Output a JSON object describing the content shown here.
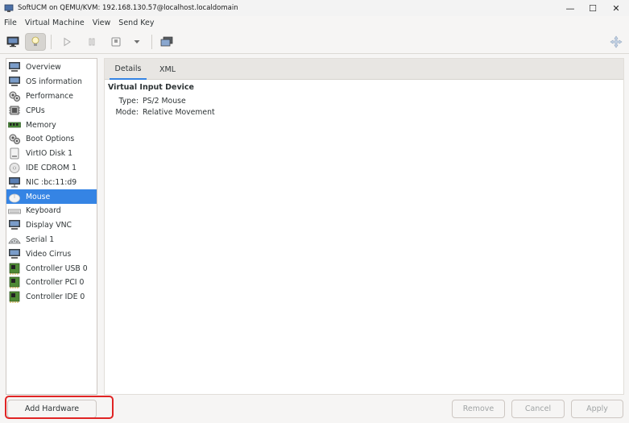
{
  "window": {
    "title": "SoftUCM on QEMU/KVM: 192.168.130.57@localhost.localdomain",
    "minimize": "—",
    "maximize": "☐",
    "close": "✕"
  },
  "menu": [
    "File",
    "Virtual Machine",
    "View",
    "Send Key"
  ],
  "sidebar": {
    "items": [
      {
        "label": "Overview",
        "icon": "monitor-icon"
      },
      {
        "label": "OS information",
        "icon": "monitor-icon"
      },
      {
        "label": "Performance",
        "icon": "gears-icon"
      },
      {
        "label": "CPUs",
        "icon": "cpu-chip-icon"
      },
      {
        "label": "Memory",
        "icon": "memory-module-icon"
      },
      {
        "label": "Boot Options",
        "icon": "gears-icon"
      },
      {
        "label": "VirtIO Disk 1",
        "icon": "disk-icon"
      },
      {
        "label": "IDE CDROM 1",
        "icon": "cdrom-icon"
      },
      {
        "label": "NIC :bc:11:d9",
        "icon": "network-icon"
      },
      {
        "label": "Mouse",
        "icon": "mouse-icon"
      },
      {
        "label": "Keyboard",
        "icon": "keyboard-icon"
      },
      {
        "label": "Display VNC",
        "icon": "monitor-icon"
      },
      {
        "label": "Serial 1",
        "icon": "serial-port-icon"
      },
      {
        "label": "Video Cirrus",
        "icon": "monitor-icon"
      },
      {
        "label": "Controller USB 0",
        "icon": "controller-card-icon"
      },
      {
        "label": "Controller PCI 0",
        "icon": "controller-card-icon"
      },
      {
        "label": "Controller IDE 0",
        "icon": "controller-card-icon"
      }
    ],
    "selected": "Mouse"
  },
  "tabs": [
    "Details",
    "XML"
  ],
  "details": {
    "title": "Virtual Input Device",
    "type_label": "Type:",
    "type_value": "PS/2 Mouse",
    "mode_label": "Mode:",
    "mode_value": "Relative Movement"
  },
  "buttons": {
    "add_hardware": "Add Hardware",
    "remove": "Remove",
    "cancel": "Cancel",
    "apply": "Apply"
  },
  "colors": {
    "selection": "#3584e4",
    "highlight_border": "#e02424"
  }
}
